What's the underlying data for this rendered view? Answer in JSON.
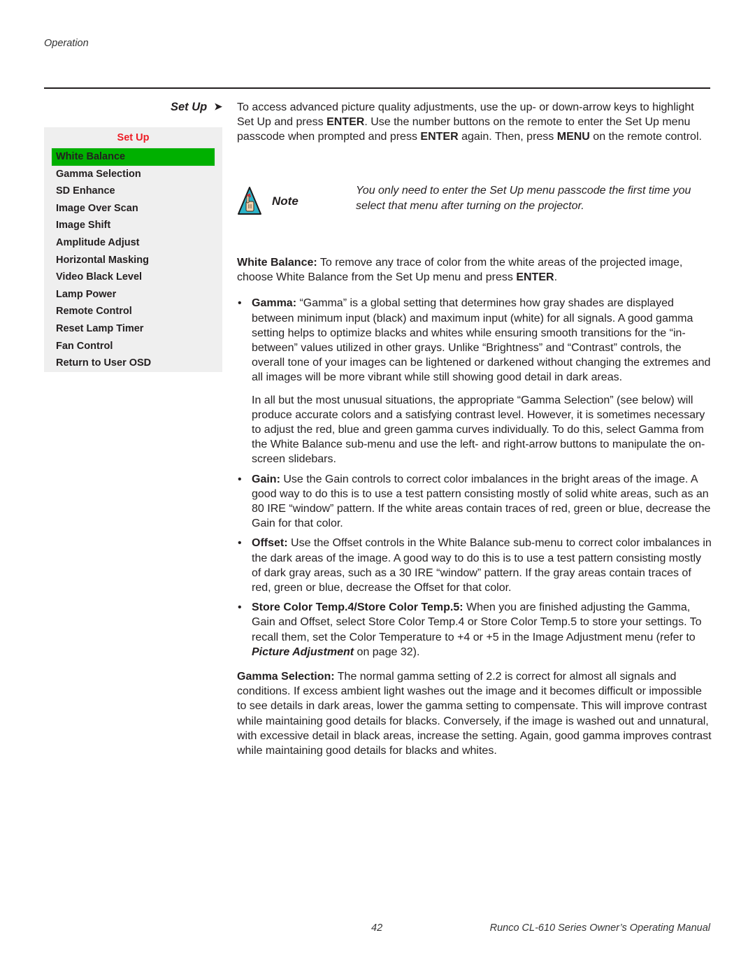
{
  "header": {
    "section": "Operation"
  },
  "sidebar": {
    "heading": "Set Up",
    "arrow_icon": "right-arrowhead",
    "osd_menu": {
      "title": "Set Up",
      "title_color": "#ee1c25",
      "highlight_color": "#00b000",
      "selected": "White Balance",
      "items": [
        "White Balance",
        "Gamma Selection",
        "SD Enhance",
        "Image Over Scan",
        "Image Shift",
        "Amplitude Adjust",
        "Horizontal Masking",
        "Video Black Level",
        "Lamp Power",
        "Remote Control",
        "Reset Lamp Timer",
        "Fan Control",
        "Return to User OSD"
      ]
    }
  },
  "intro": {
    "t1": "To access advanced picture quality adjustments, use the up- or down-arrow keys to highlight Set Up and press ",
    "b1": "ENTER",
    "t2": ". Use the number buttons on the remote to enter the Set Up menu passcode when prompted and press ",
    "b2": "ENTER",
    "t3": " again. Then, press ",
    "b3": "MENU",
    "t4": " on the remote control."
  },
  "note": {
    "icon": "note-hand-icon",
    "label": "Note",
    "text": "You only need to enter the Set Up menu passcode the first time you select that menu after turning on the projector."
  },
  "white_balance": {
    "term": "White Balance:",
    "t1": " To remove any trace of color from the white areas of the projected image, choose White Balance from the Set Up menu and press ",
    "b1": "ENTER",
    "t2": ".",
    "bullets": {
      "gamma": {
        "term": "Gamma:",
        "text": " “Gamma” is a global setting that determines how gray shades are displayed between minimum input (black) and maximum input (white) for all signals. A good gamma setting helps to optimize blacks and whites while ensuring smooth transitions for the “in-between” values utilized in other grays. Unlike “Brightness” and “Contrast” controls, the overall tone of your images can be lightened or darkened without changing the extremes and all images will be more vibrant while still showing good detail in dark areas.",
        "extra": "In all but the most unusual situations, the appropriate “Gamma Selection” (see below) will produce accurate colors and a satisfying contrast level. However, it is sometimes necessary to adjust the red, blue and green gamma curves individually. To do this, select Gamma from the White Balance sub-menu and use the left- and right-arrow buttons to manipulate the on-screen slidebars."
      },
      "gain": {
        "term": "Gain:",
        "text": " Use the Gain controls to correct color imbalances in the bright areas of the image. A good way to do this is to use a test pattern consisting mostly of solid white areas, such as an 80 IRE “window” pattern. If the white areas contain traces of red, green or blue, decrease the Gain for that color."
      },
      "offset": {
        "term": "Offset:",
        "text": " Use the Offset controls in the White Balance sub-menu to correct color imbalances in the dark areas of the image. A good way to do this is to use a test pattern consisting mostly of dark gray areas, such as a 30 IRE “window” pattern. If the gray areas contain traces of red, green or blue, decrease the Offset for that color."
      },
      "store": {
        "term": "Store Color Temp.4/Store Color Temp.5:",
        "t1": " When you are finished adjusting the Gamma, Gain and Offset, select Store Color Temp.4 or Store Color Temp.5 to store your settings. To recall them, set the Color Temperature to +4 or +5 in the Image Adjustment menu (refer to ",
        "link": "Picture Adjustment",
        "t2": " on page 32)."
      }
    }
  },
  "gamma_selection": {
    "term": "Gamma Selection:",
    "text": " The normal gamma setting of 2.2 is correct for almost all signals and conditions. If excess ambient light washes out the image and it becomes difficult or impossible to see details in dark areas, lower the gamma setting to compensate. This will improve contrast while maintaining good details for blacks. Conversely, if the image is washed out and unnatural, with excessive detail in black areas, increase the setting. Again, good gamma improves contrast while maintaining good details for blacks and whites."
  },
  "footer": {
    "page_number": "42",
    "manual_title": "Runco CL-610 Series Owner’s Operating Manual"
  }
}
